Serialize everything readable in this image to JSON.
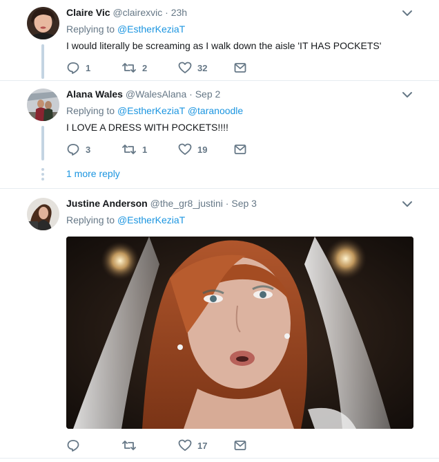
{
  "tweets": [
    {
      "name": "Claire Vic",
      "handle": "@clairexvic",
      "time": "23h",
      "replying_prefix": "Replying to",
      "replying_to": [
        "@EstherKeziaT"
      ],
      "text": "I would literally be screaming as I walk down the aisle 'IT HAS POCKETS'",
      "reply_count": "1",
      "retweet_count": "2",
      "like_count": "32"
    },
    {
      "name": "Alana Wales",
      "handle": "@WalesAlana",
      "time": "Sep 2",
      "replying_prefix": "Replying to",
      "replying_to": [
        "@EstherKeziaT",
        "@taranoodle"
      ],
      "text": "I LOVE A DRESS WITH POCKETS!!!!",
      "reply_count": "3",
      "retweet_count": "1",
      "like_count": "19",
      "more_replies": "1 more reply"
    },
    {
      "name": "Justine Anderson",
      "handle": "@the_gr8_justini",
      "time": "Sep 3",
      "replying_prefix": "Replying to",
      "replying_to": [
        "@EstherKeziaT"
      ],
      "reply_count": "",
      "retweet_count": "",
      "like_count": "17"
    }
  ],
  "separator": "·",
  "colors": {
    "link": "#1b95e0",
    "muted": "#657786",
    "text": "#14171a",
    "thread_line": "#c4d4e2",
    "divider": "#e6ecf0"
  },
  "icons": {
    "reply": "reply-icon",
    "retweet": "retweet-icon",
    "like": "heart-icon",
    "dm": "envelope-icon",
    "more": "chevron-down-icon"
  }
}
